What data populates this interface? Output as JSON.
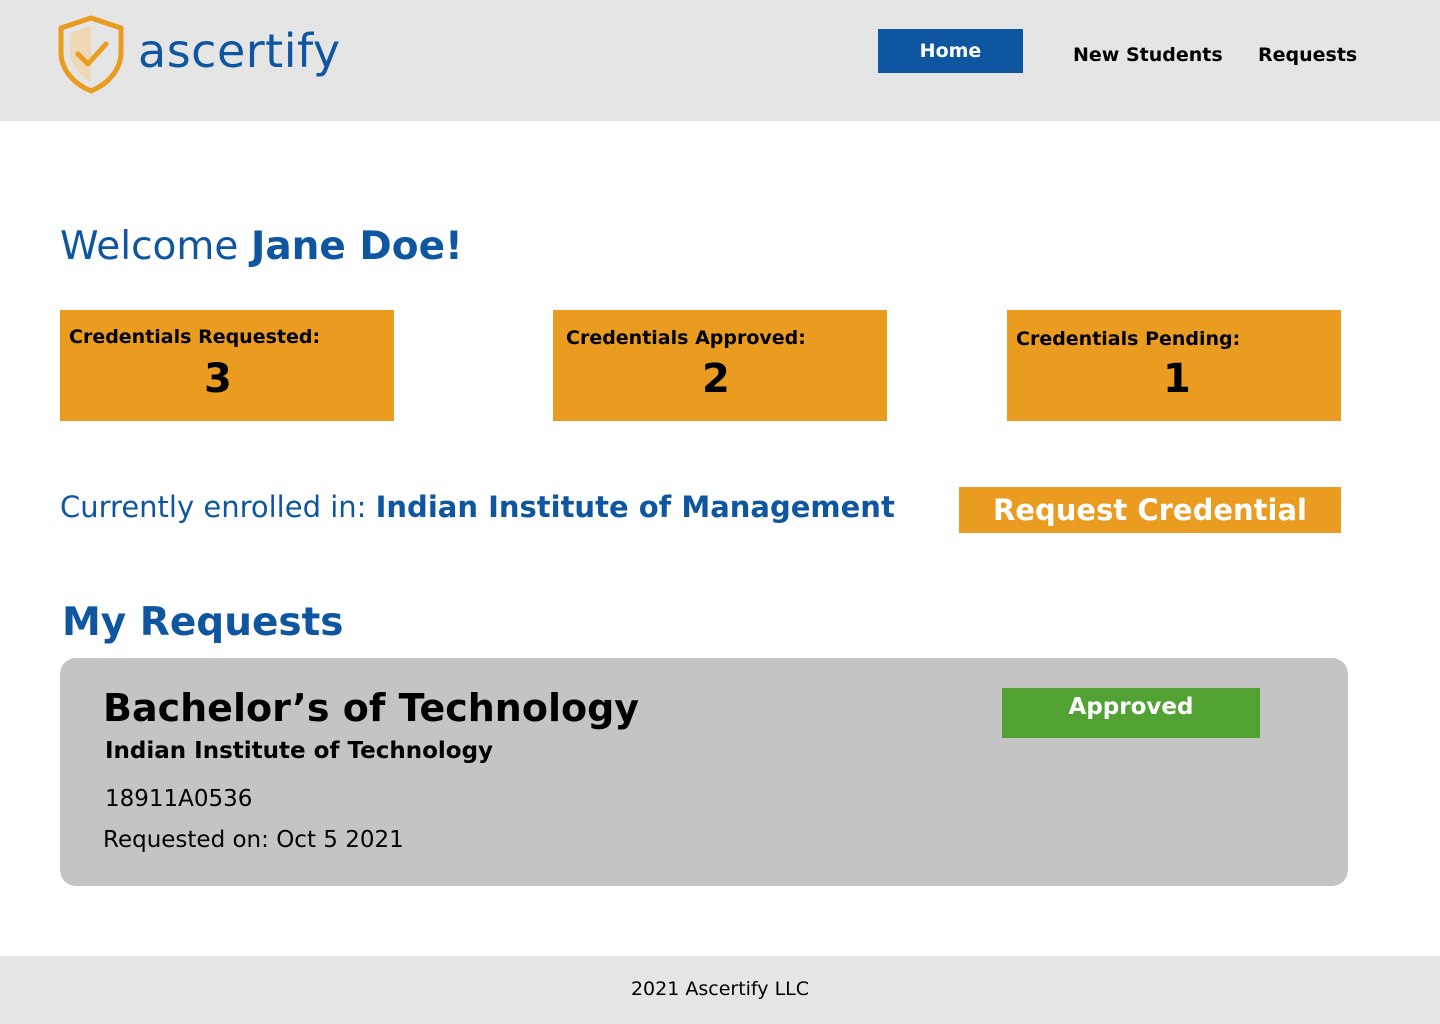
{
  "brand": {
    "name": "ascertify",
    "logo_icon": "shield-check-icon",
    "colors": {
      "primary": "#0f56a0",
      "accent": "#ea9c21",
      "success": "#52a233",
      "header_bg": "#e5e5e5",
      "card_bg": "#c4c4c4"
    }
  },
  "nav": {
    "items": [
      {
        "label": "Home",
        "active": true
      },
      {
        "label": "New Students",
        "active": false
      },
      {
        "label": "Requests",
        "active": false
      }
    ]
  },
  "welcome": {
    "prefix": "Welcome",
    "name": "Jane Doe!"
  },
  "stats": [
    {
      "label": "Credentials Requested:",
      "value": "3"
    },
    {
      "label": "Credentials Approved:",
      "value": "2"
    },
    {
      "label": "Credentials Pending:",
      "value": "1"
    }
  ],
  "enrollment": {
    "prefix": "Currently enrolled in:",
    "institution": "Indian Institute of Management"
  },
  "request_button_label": "Request Credential",
  "requests": {
    "title": "My Requests",
    "items": [
      {
        "degree": "Bachelor’s of Technology",
        "institution": "Indian Institute of Technology",
        "id": "18911A0536",
        "requested_on": "Requested on: Oct 5 2021",
        "status": "Approved"
      }
    ]
  },
  "footer": {
    "text": "2021 Ascertify LLC"
  }
}
